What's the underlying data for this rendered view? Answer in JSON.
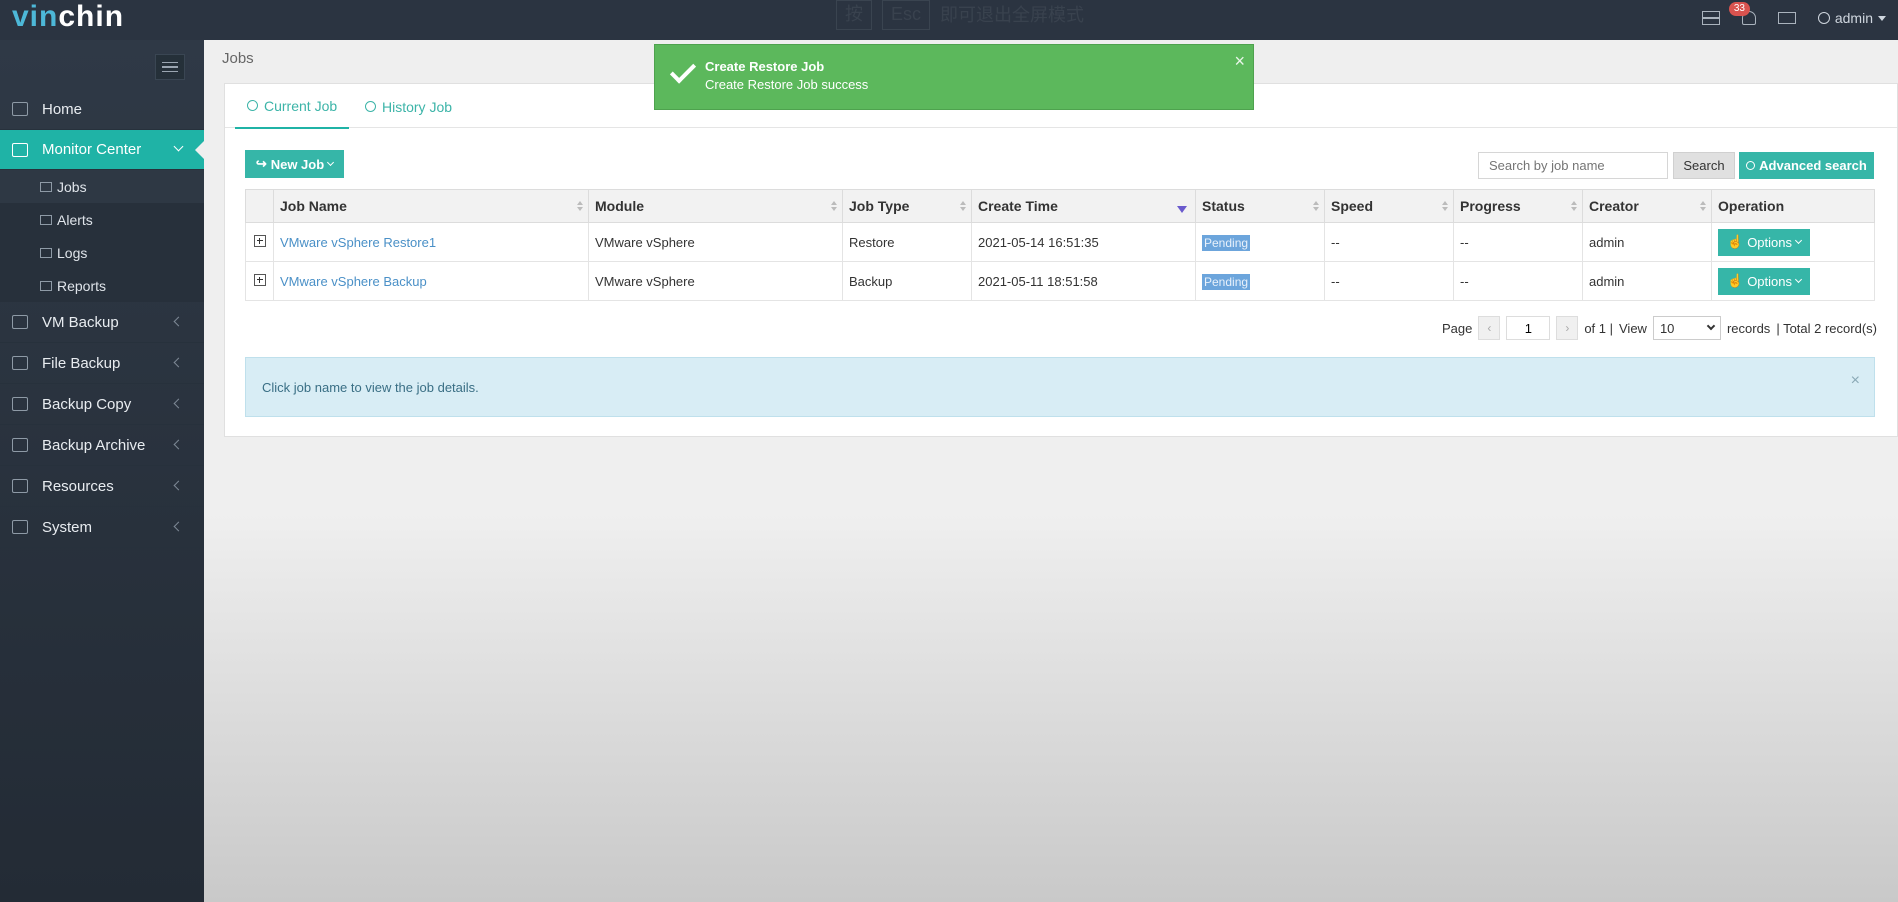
{
  "app": {
    "logo_part1": "vin",
    "logo_part2": "chin",
    "fullscreen_hint_key1": "按",
    "fullscreen_hint_key2": "Esc",
    "fullscreen_hint_text": "即可退出全屏模式",
    "notification_count": "33",
    "user": "admin"
  },
  "sidebar": {
    "items": [
      {
        "label": "Home",
        "icon": "home-icon"
      },
      {
        "label": "Monitor Center",
        "icon": "monitor-icon"
      },
      {
        "label": "VM Backup",
        "icon": "vm-icon"
      },
      {
        "label": "File Backup",
        "icon": "file-icon"
      },
      {
        "label": "Backup Copy",
        "icon": "copy-icon"
      },
      {
        "label": "Backup Archive",
        "icon": "archive-icon"
      },
      {
        "label": "Resources",
        "icon": "resources-icon"
      },
      {
        "label": "System",
        "icon": "gear-icon"
      }
    ],
    "sub_items": [
      {
        "label": "Jobs",
        "icon": "jobs-icon"
      },
      {
        "label": "Alerts",
        "icon": "bell-icon"
      },
      {
        "label": "Logs",
        "icon": "log-icon"
      },
      {
        "label": "Reports",
        "icon": "report-icon"
      }
    ]
  },
  "page": {
    "title": "Jobs",
    "tabs": [
      "Current Job",
      "History Job"
    ],
    "new_job": "New Job",
    "search_placeholder": "Search by job name",
    "search_btn": "Search",
    "adv_search_btn": "Advanced search"
  },
  "table": {
    "headers": [
      "Job Name",
      "Module",
      "Job Type",
      "Create Time",
      "Status",
      "Speed",
      "Progress",
      "Creator",
      "Operation"
    ],
    "rows": [
      {
        "name": "VMware vSphere Restore1",
        "module": "VMware vSphere",
        "type": "Restore",
        "time": "2021-05-14 16:51:35",
        "status": "Pending",
        "speed": "--",
        "progress": "--",
        "creator": "admin",
        "op": "Options"
      },
      {
        "name": "VMware vSphere Backup",
        "module": "VMware vSphere",
        "type": "Backup",
        "time": "2021-05-11 18:51:58",
        "status": "Pending",
        "speed": "--",
        "progress": "--",
        "creator": "admin",
        "op": "Options"
      }
    ]
  },
  "pager": {
    "page_label": "Page",
    "prev": "‹",
    "next": "›",
    "page": "1",
    "of": "of 1 |",
    "view": "View",
    "per_page": "10",
    "records": "records",
    "total": "| Total 2 record(s)"
  },
  "info": {
    "text": "Click job name to view the job details.",
    "close": "×"
  },
  "toast": {
    "title": "Create Restore Job",
    "message": "Create Restore Job success",
    "close": "×"
  }
}
